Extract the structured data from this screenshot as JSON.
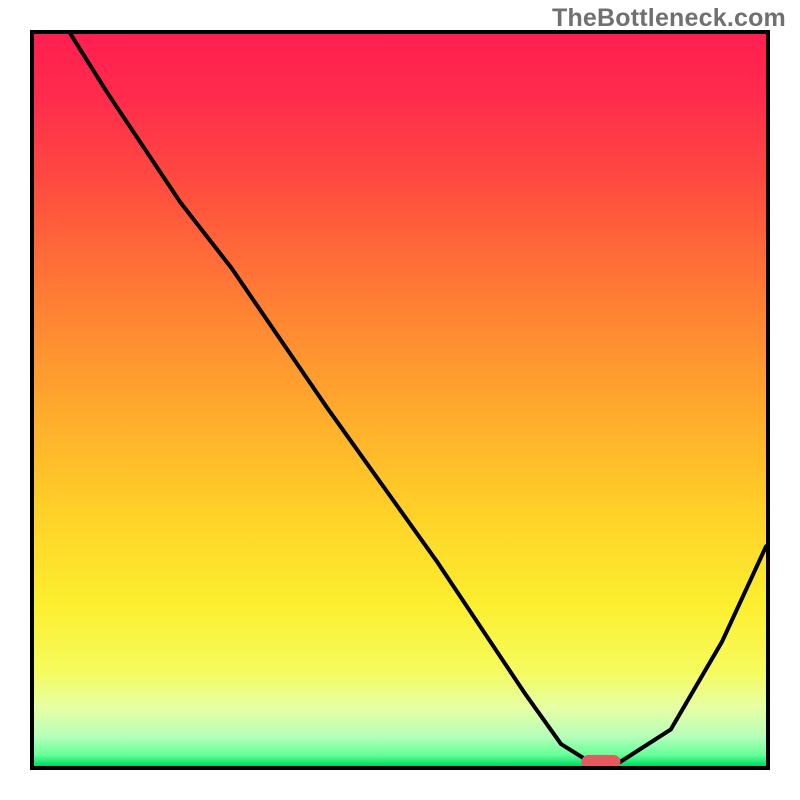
{
  "watermark": "TheBottleneck.com",
  "chart_data": {
    "type": "line",
    "title": "",
    "xlabel": "",
    "ylabel": "",
    "xlim": [
      0,
      100
    ],
    "ylim": [
      0,
      100
    ],
    "grid": false,
    "legend": false,
    "series": [
      {
        "name": "curve",
        "x": [
          5,
          10,
          20,
          27,
          40,
          55,
          67,
          72,
          76,
          80,
          87,
          94,
          100
        ],
        "y": [
          100,
          92,
          77,
          68,
          49,
          28,
          10,
          3,
          0.5,
          0.5,
          5,
          17,
          30
        ]
      }
    ],
    "gradient_stops": [
      {
        "offset": 0.0,
        "color": "#ff1f4f"
      },
      {
        "offset": 0.08,
        "color": "#ff2a4d"
      },
      {
        "offset": 0.2,
        "color": "#ff4a40"
      },
      {
        "offset": 0.35,
        "color": "#ff7a35"
      },
      {
        "offset": 0.5,
        "color": "#ffa62d"
      },
      {
        "offset": 0.65,
        "color": "#ffd028"
      },
      {
        "offset": 0.78,
        "color": "#fcef2f"
      },
      {
        "offset": 0.87,
        "color": "#f6fb5e"
      },
      {
        "offset": 0.92,
        "color": "#e6ffa3"
      },
      {
        "offset": 0.96,
        "color": "#b6ffba"
      },
      {
        "offset": 0.985,
        "color": "#66ff99"
      },
      {
        "offset": 1.0,
        "color": "#00d860"
      }
    ],
    "marker": {
      "x": 77.5,
      "y": 0.5,
      "color": "#e35a60"
    }
  }
}
